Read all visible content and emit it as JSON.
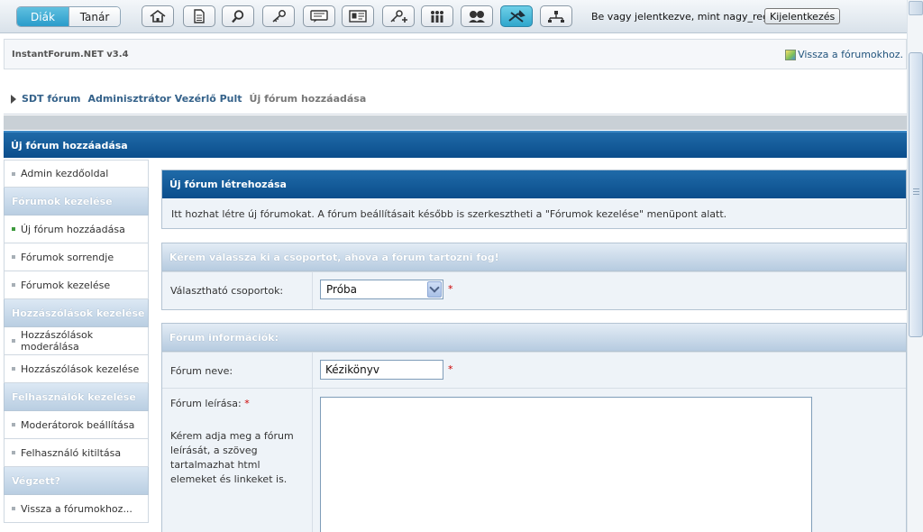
{
  "toolbar": {
    "role_student": "Diák",
    "role_teacher": "Tanár",
    "login_text": "Be vagy jelentkezve, mint nagy_regina",
    "logout_label": "Kijelentkezés",
    "icons": [
      "home-icon",
      "document-icon",
      "search-icon",
      "key-icon",
      "chat-icon",
      "card-icon",
      "key-add-icon",
      "group-icon",
      "users-icon",
      "admin-tools-icon",
      "network-icon"
    ]
  },
  "forum_header": {
    "version": "InstantForum.NET v3.4",
    "back_link": "Vissza a fórumokhoz."
  },
  "breadcrumb": {
    "items": [
      "SDT fórum",
      "Adminisztrátor Vezérlő Pult"
    ],
    "current": "Új fórum hozzáadása"
  },
  "page_title": "Új fórum hozzáadása",
  "sidebar": {
    "admin_home": "Admin kezdőoldal",
    "forums_heading": "Fórumok kezelése",
    "new_forum": "Új fórum hozzáadása",
    "forum_order": "Fórumok sorrendje",
    "forum_manage": "Fórumok kezelése",
    "posts_heading": "Hozzászólások kezelése",
    "posts_moderate": "Hozzászólások moderálása",
    "posts_manage": "Hozzászólások kezelése",
    "users_heading": "Felhasználók kezelése",
    "moderators": "Moderátorok beállítása",
    "user_ban": "Felhasználó kitiltása",
    "done_heading": "Végzett?",
    "back_forums": "Vissza a fórumokhoz..."
  },
  "create_box": {
    "title": "Új fórum létrehozása",
    "text": "Itt hozhat létre új fórumokat. A fórum beállításait később is szerkesztheti a \"Fórumok kezelése\" menüpont alatt."
  },
  "group_section": {
    "title": "Kérem válassza ki a csoportot, ahova a fórum tartozni fog!",
    "label": "Választható csoportok:",
    "selected": "Próba"
  },
  "info_section": {
    "title": "Fórum információk:",
    "name_label": "Fórum neve:",
    "name_value": "Kézikönyv",
    "desc_label": "Fórum leírása:",
    "desc_help": "Kérem adja meg a fórum leírását, a szöveg tartalmazhat html elemeket és linkeket is.",
    "required_mark": "*"
  },
  "colors": {
    "title_bar": "#0b4e8c",
    "active_toggle": "#2a9ccb",
    "required": "#cc0000"
  }
}
